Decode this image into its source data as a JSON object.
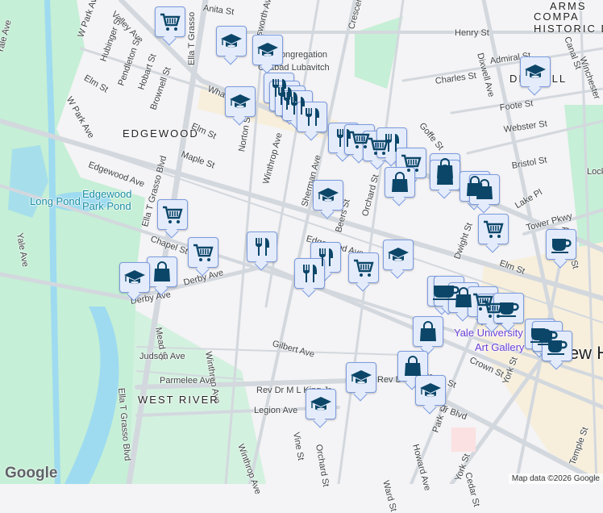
{
  "map": {
    "labels": [
      "Anita St",
      "Ellsworth Ave",
      "Valley Ave",
      "W Park Ave",
      "Hubinger St",
      "Pendleton St",
      "Hobart St",
      "Brownell St",
      "Ella T Grasso",
      "Elm St",
      "W Park Ave",
      "EDGEWOOD",
      "Elm St",
      "Maple St",
      "Norton St",
      "Winthrop Ave",
      "Edgewood Ave",
      "Long Pond",
      "Edgewood",
      "Park Pond",
      "Ella T Grasso Blvd",
      "Yale Ave",
      "Yale Ave",
      "Chapel St",
      "Derby Ave",
      "Derby Ave",
      "Mead St",
      "Ella T Grasso Blvd",
      "Winthrop Ave",
      "Judson Ave",
      "Gilbert Ave",
      "Parmelee Ave",
      "WEST RIVER",
      "Rev Dr M L King Jr",
      "Legion Ave",
      "Winthrop Ave",
      "Sherman Ave",
      "Beers St",
      "Orchard St",
      "Edgewood Ave",
      "Henry St",
      "Dixwell Ave",
      "Admiral St",
      "Charles St",
      "Foote St",
      "Webster St",
      "Goffe St",
      "Bristol St",
      "Lake Pl",
      "Tower Pkwy",
      "Ashmun St",
      "Canal St",
      "Winchester",
      "ARMS",
      "COMPA",
      "HISTORIC DI",
      "DIXWELL",
      "Lock",
      "Congregation",
      "Chabad Lubavitch",
      "Crescent",
      "Dwight St",
      "Elm St",
      "York St",
      "Crown St",
      "Park St",
      "Howard Ave",
      "Ward St",
      "York St",
      "Temple St",
      "Yale University",
      "Art Gallery",
      "New H",
      "Vine St",
      "Orchard St",
      "George St",
      "Jr Blvd",
      "Cedar St",
      "Rev D",
      "Whalley Ave"
    ],
    "marker_types": {
      "cart": "shopping-cart-icon",
      "grad": "graduation-cap-icon",
      "fork": "restaurant-icon",
      "bag": "shopping-bag-icon",
      "cup": "coffee-cup-icon"
    },
    "colors": {
      "icon": "#0b4669",
      "marker_bg": "#e4ecfb",
      "marker_border": "#7b9be0",
      "park": "#bfecd0",
      "water": "#9edbf0",
      "road": "#d3d8de"
    },
    "attribution": "Map data ©2026 Google",
    "logo": "Google"
  }
}
